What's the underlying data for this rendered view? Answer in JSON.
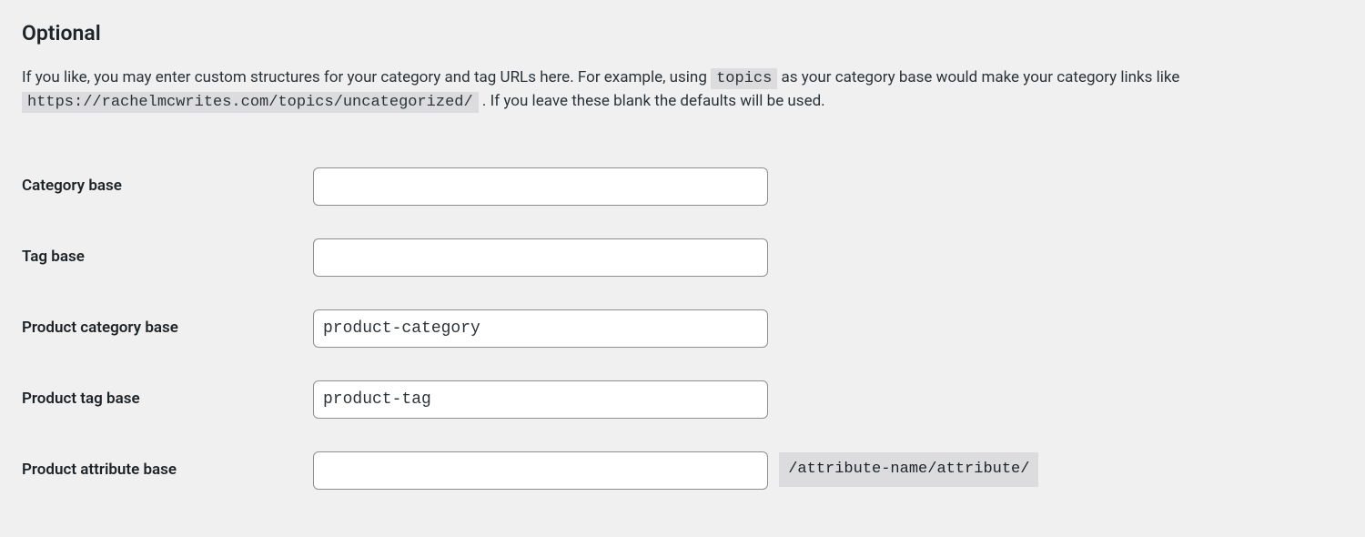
{
  "heading": "Optional",
  "description": {
    "part1": "If you like, you may enter custom structures for your category and tag URLs here. For example, using ",
    "code1": "topics",
    "part2": " as your category base would make your category links like ",
    "code2": "https://rachelmcwrites.com/topics/uncategorized/",
    "part3": " . If you leave these blank the defaults will be used."
  },
  "fields": {
    "category_base": {
      "label": "Category base",
      "value": ""
    },
    "tag_base": {
      "label": "Tag base",
      "value": ""
    },
    "product_category_base": {
      "label": "Product category base",
      "value": "product-category"
    },
    "product_tag_base": {
      "label": "Product tag base",
      "value": "product-tag"
    },
    "product_attribute_base": {
      "label": "Product attribute base",
      "value": "",
      "suffix": "/attribute-name/attribute/"
    }
  }
}
